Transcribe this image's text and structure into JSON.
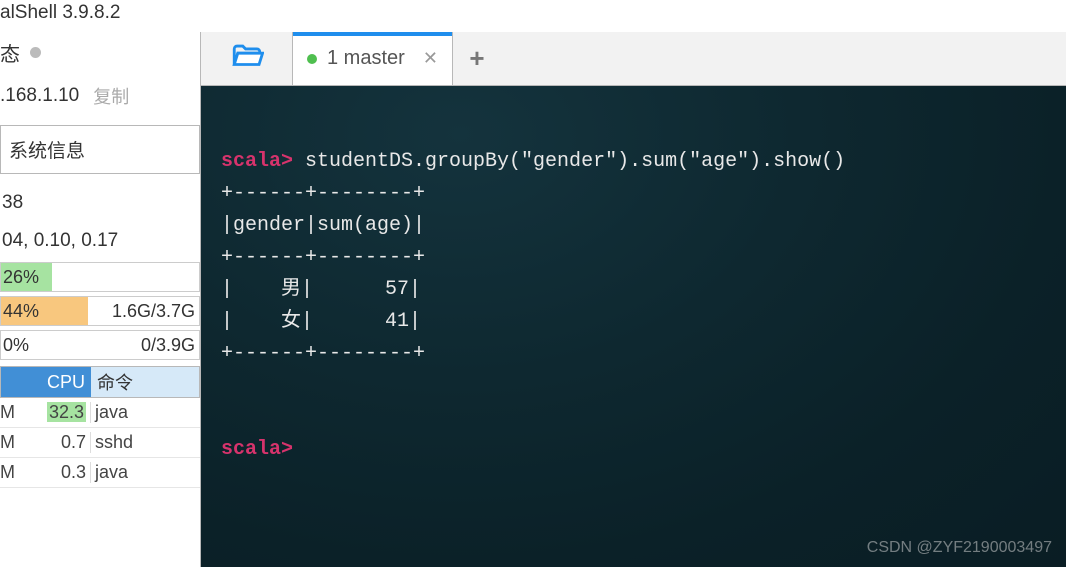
{
  "app_title": "alShell 3.9.8.2",
  "left": {
    "status_label": "态",
    "ip": ".168.1.10",
    "copy": "复制",
    "sysinfo_label": "系统信息",
    "metric1": "38",
    "metric2": "04, 0.10, 0.17",
    "bar1": {
      "pct": "26%",
      "width": 26
    },
    "bar2": {
      "pct": "44%",
      "right": "1.6G/3.7G",
      "width": 44
    },
    "bar3": {
      "pct": "0%",
      "right": "0/3.9G",
      "width": 0
    },
    "proc_header": {
      "cpu": "CPU",
      "cmd": "命令"
    },
    "procs": [
      {
        "m": "M",
        "cpu": "32.3",
        "cmd": "java",
        "hl": true
      },
      {
        "m": "M",
        "cpu": "0.7",
        "cmd": "sshd",
        "hl": false
      },
      {
        "m": "M",
        "cpu": "0.3",
        "cmd": "java",
        "hl": false
      }
    ]
  },
  "tabs": {
    "active": {
      "label": "1 master"
    }
  },
  "terminal": {
    "prompt": "scala>",
    "command": " studentDS.groupBy(\"gender\").sum(\"age\").show()",
    "sep": "+------+--------+",
    "header": "|gender|sum(age)|",
    "row1": "|    男|      57|",
    "row2": "|    女|      41|",
    "prompt2": "scala>"
  },
  "watermark": "CSDN @ZYF2190003497"
}
